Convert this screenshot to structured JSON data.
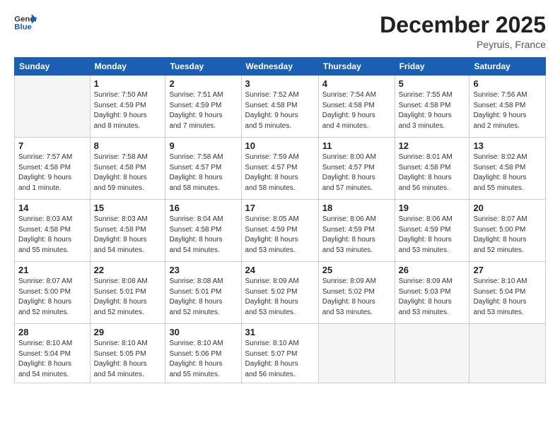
{
  "header": {
    "logo_line1": "General",
    "logo_line2": "Blue",
    "month": "December 2025",
    "location": "Peyruis, France"
  },
  "weekdays": [
    "Sunday",
    "Monday",
    "Tuesday",
    "Wednesday",
    "Thursday",
    "Friday",
    "Saturday"
  ],
  "weeks": [
    [
      {
        "day": "",
        "info": ""
      },
      {
        "day": "1",
        "info": "Sunrise: 7:50 AM\nSunset: 4:59 PM\nDaylight: 9 hours\nand 8 minutes."
      },
      {
        "day": "2",
        "info": "Sunrise: 7:51 AM\nSunset: 4:59 PM\nDaylight: 9 hours\nand 7 minutes."
      },
      {
        "day": "3",
        "info": "Sunrise: 7:52 AM\nSunset: 4:58 PM\nDaylight: 9 hours\nand 5 minutes."
      },
      {
        "day": "4",
        "info": "Sunrise: 7:54 AM\nSunset: 4:58 PM\nDaylight: 9 hours\nand 4 minutes."
      },
      {
        "day": "5",
        "info": "Sunrise: 7:55 AM\nSunset: 4:58 PM\nDaylight: 9 hours\nand 3 minutes."
      },
      {
        "day": "6",
        "info": "Sunrise: 7:56 AM\nSunset: 4:58 PM\nDaylight: 9 hours\nand 2 minutes."
      }
    ],
    [
      {
        "day": "7",
        "info": "Sunrise: 7:57 AM\nSunset: 4:58 PM\nDaylight: 9 hours\nand 1 minute."
      },
      {
        "day": "8",
        "info": "Sunrise: 7:58 AM\nSunset: 4:58 PM\nDaylight: 8 hours\nand 59 minutes."
      },
      {
        "day": "9",
        "info": "Sunrise: 7:58 AM\nSunset: 4:57 PM\nDaylight: 8 hours\nand 58 minutes."
      },
      {
        "day": "10",
        "info": "Sunrise: 7:59 AM\nSunset: 4:57 PM\nDaylight: 8 hours\nand 58 minutes."
      },
      {
        "day": "11",
        "info": "Sunrise: 8:00 AM\nSunset: 4:57 PM\nDaylight: 8 hours\nand 57 minutes."
      },
      {
        "day": "12",
        "info": "Sunrise: 8:01 AM\nSunset: 4:58 PM\nDaylight: 8 hours\nand 56 minutes."
      },
      {
        "day": "13",
        "info": "Sunrise: 8:02 AM\nSunset: 4:58 PM\nDaylight: 8 hours\nand 55 minutes."
      }
    ],
    [
      {
        "day": "14",
        "info": "Sunrise: 8:03 AM\nSunset: 4:58 PM\nDaylight: 8 hours\nand 55 minutes."
      },
      {
        "day": "15",
        "info": "Sunrise: 8:03 AM\nSunset: 4:58 PM\nDaylight: 8 hours\nand 54 minutes."
      },
      {
        "day": "16",
        "info": "Sunrise: 8:04 AM\nSunset: 4:58 PM\nDaylight: 8 hours\nand 54 minutes."
      },
      {
        "day": "17",
        "info": "Sunrise: 8:05 AM\nSunset: 4:59 PM\nDaylight: 8 hours\nand 53 minutes."
      },
      {
        "day": "18",
        "info": "Sunrise: 8:06 AM\nSunset: 4:59 PM\nDaylight: 8 hours\nand 53 minutes."
      },
      {
        "day": "19",
        "info": "Sunrise: 8:06 AM\nSunset: 4:59 PM\nDaylight: 8 hours\nand 53 minutes."
      },
      {
        "day": "20",
        "info": "Sunrise: 8:07 AM\nSunset: 5:00 PM\nDaylight: 8 hours\nand 52 minutes."
      }
    ],
    [
      {
        "day": "21",
        "info": "Sunrise: 8:07 AM\nSunset: 5:00 PM\nDaylight: 8 hours\nand 52 minutes."
      },
      {
        "day": "22",
        "info": "Sunrise: 8:08 AM\nSunset: 5:01 PM\nDaylight: 8 hours\nand 52 minutes."
      },
      {
        "day": "23",
        "info": "Sunrise: 8:08 AM\nSunset: 5:01 PM\nDaylight: 8 hours\nand 52 minutes."
      },
      {
        "day": "24",
        "info": "Sunrise: 8:09 AM\nSunset: 5:02 PM\nDaylight: 8 hours\nand 53 minutes."
      },
      {
        "day": "25",
        "info": "Sunrise: 8:09 AM\nSunset: 5:02 PM\nDaylight: 8 hours\nand 53 minutes."
      },
      {
        "day": "26",
        "info": "Sunrise: 8:09 AM\nSunset: 5:03 PM\nDaylight: 8 hours\nand 53 minutes."
      },
      {
        "day": "27",
        "info": "Sunrise: 8:10 AM\nSunset: 5:04 PM\nDaylight: 8 hours\nand 53 minutes."
      }
    ],
    [
      {
        "day": "28",
        "info": "Sunrise: 8:10 AM\nSunset: 5:04 PM\nDaylight: 8 hours\nand 54 minutes."
      },
      {
        "day": "29",
        "info": "Sunrise: 8:10 AM\nSunset: 5:05 PM\nDaylight: 8 hours\nand 54 minutes."
      },
      {
        "day": "30",
        "info": "Sunrise: 8:10 AM\nSunset: 5:06 PM\nDaylight: 8 hours\nand 55 minutes."
      },
      {
        "day": "31",
        "info": "Sunrise: 8:10 AM\nSunset: 5:07 PM\nDaylight: 8 hours\nand 56 minutes."
      },
      {
        "day": "",
        "info": ""
      },
      {
        "day": "",
        "info": ""
      },
      {
        "day": "",
        "info": ""
      }
    ]
  ]
}
